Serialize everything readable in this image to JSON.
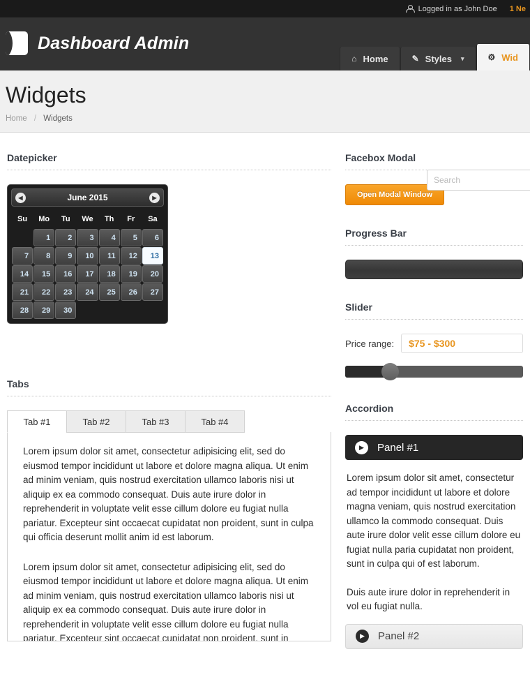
{
  "topbar": {
    "user_icon": "user-icon",
    "logged_in_text": "Logged in as John Doe",
    "notification_text": "1 Ne",
    "accent_color": "#e8951f"
  },
  "masthead": {
    "logo_icon": "brand-logo-icon",
    "brand_title": "Dashboard Admin",
    "nav": [
      {
        "label": "Home",
        "icon": "home-icon",
        "glyph": "⌂",
        "active": false,
        "caret": ""
      },
      {
        "label": "Styles",
        "icon": "pencil-icon",
        "glyph": "✎",
        "active": false,
        "caret": "▾"
      },
      {
        "label": "Wid",
        "icon": "gear-icon",
        "glyph": "⚙",
        "active": true,
        "caret": ""
      }
    ]
  },
  "titleband": {
    "page_title": "Widgets",
    "breadcrumb": {
      "home": "Home",
      "separator": "/",
      "current": "Widgets"
    },
    "search_placeholder": "Search"
  },
  "sections": {
    "datepicker_heading": "Datepicker",
    "tabs_heading": "Tabs",
    "facebox_heading": "Facebox Modal",
    "progress_heading": "Progress Bar",
    "slider_heading": "Slider",
    "accordion_heading": "Accordion"
  },
  "datepicker": {
    "prev_icon": "chevron-left-icon",
    "prev_glyph": "◀",
    "next_icon": "chevron-right-icon",
    "next_glyph": "▶",
    "month_label": "June 2015",
    "weekdays": [
      "Su",
      "Mo",
      "Tu",
      "We",
      "Th",
      "Fr",
      "Sa"
    ],
    "lead_blanks": 1,
    "days": [
      1,
      2,
      3,
      4,
      5,
      6,
      7,
      8,
      9,
      10,
      11,
      12,
      13,
      14,
      15,
      16,
      17,
      18,
      19,
      20,
      21,
      22,
      23,
      24,
      25,
      26,
      27,
      28,
      29,
      30
    ],
    "today": 13
  },
  "tabs": {
    "items": [
      {
        "label": "Tab #1",
        "active": true
      },
      {
        "label": "Tab #2",
        "active": false
      },
      {
        "label": "Tab #3",
        "active": false
      },
      {
        "label": "Tab #4",
        "active": false
      }
    ],
    "panel_paragraphs": [
      "Lorem ipsum dolor sit amet, consectetur adipisicing elit, sed do eiusmod tempor incididunt ut labore et dolore magna aliqua. Ut enim ad minim veniam, quis nostrud exercitation ullamco laboris nisi ut aliquip ex ea commodo consequat. Duis aute irure dolor in reprehenderit in voluptate velit esse cillum dolore eu fugiat nulla pariatur. Excepteur sint occaecat cupidatat non proident, sunt in culpa qui officia deserunt mollit anim id est laborum.",
      "Lorem ipsum dolor sit amet, consectetur adipisicing elit, sed do eiusmod tempor incididunt ut labore et dolore magna aliqua. Ut enim ad minim veniam, quis nostrud exercitation ullamco laboris nisi ut aliquip ex ea commodo consequat. Duis aute irure dolor in reprehenderit in voluptate velit esse cillum dolore eu fugiat nulla pariatur. Excepteur sint occaecat cupidatat non proident, sunt in"
    ]
  },
  "facebox": {
    "button_label": "Open Modal Window",
    "button_color": "#ef8a06"
  },
  "progress": {
    "value_percent": 0
  },
  "slider": {
    "price_label": "Price range:",
    "price_value": "$75 - $300",
    "fill_percent": 23
  },
  "accordion": {
    "panels": [
      {
        "label": "Panel #1",
        "icon": "play-circle-icon",
        "glyph": "▶",
        "open": true,
        "paragraphs": [
          "Lorem ipsum dolor sit amet, consectetur ad tempor incididunt ut labore et dolore magna veniam, quis nostrud exercitation ullamco la commodo consequat. Duis aute irure dolor velit esse cillum dolore eu fugiat nulla paria cupidatat non proident, sunt in culpa qui of est laborum.",
          "Duis aute irure dolor in reprehenderit in vol eu fugiat nulla."
        ]
      },
      {
        "label": "Panel #2",
        "icon": "play-circle-icon",
        "glyph": "▶",
        "open": false,
        "paragraphs": []
      }
    ]
  }
}
